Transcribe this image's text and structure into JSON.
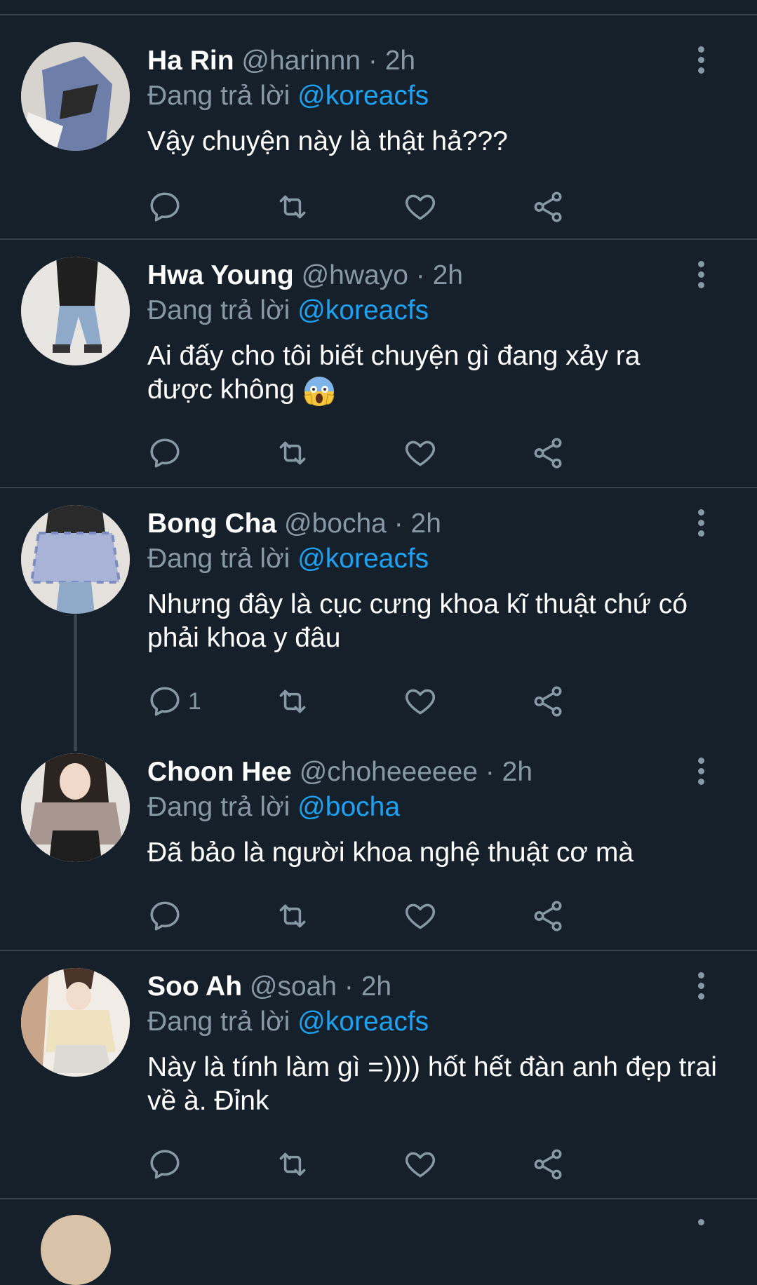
{
  "tweets": [
    {
      "name": "Ha Rin",
      "handle": "@harinnn",
      "dot": " · ",
      "time": "2h",
      "replying_prefix": "Đang trả lời ",
      "replying_to": "@koreacfs",
      "text": "Vậy chuyện này là thật hả???",
      "reply_count": ""
    },
    {
      "name": "Hwa Young",
      "handle": "@hwayo",
      "dot": " · ",
      "time": "2h",
      "replying_prefix": "Đang trả lời ",
      "replying_to": "@koreacfs",
      "text": "Ai đấy cho tôi biết chuyện gì đang xảy ra được không",
      "reply_count": ""
    },
    {
      "name": "Bong Cha",
      "handle": "@bocha",
      "dot": " · ",
      "time": "2h",
      "replying_prefix": "Đang trả lời ",
      "replying_to": "@koreacfs",
      "text": "Nhưng đây là cục cưng khoa kĩ thuật chứ có phải khoa y đâu",
      "reply_count": "1"
    },
    {
      "name": "Choon Hee",
      "handle": "@choheeeeee",
      "dot": " · ",
      "time": "2h",
      "replying_prefix": "Đang trả lời ",
      "replying_to": "@bocha",
      "text": "Đã bảo là người khoa nghệ thuật cơ mà",
      "reply_count": ""
    },
    {
      "name": "Soo Ah",
      "handle": "@soah",
      "dot": " · ",
      "time": "2h",
      "replying_prefix": "Đang trả lời ",
      "replying_to": "@koreacfs",
      "text": "Này là tính làm gì =)))) hốt hết đàn anh đẹp trai về à. Đỉnk",
      "reply_count": ""
    }
  ],
  "icons": {
    "reply": "reply-icon",
    "retweet": "retweet-icon",
    "like": "heart-icon",
    "share": "share-icon",
    "menu": "more-vertical-icon",
    "emoji": "screaming-face-emoji"
  },
  "colors": {
    "background": "#15202b",
    "secondary_text": "#8899a6",
    "mention": "#1da1f2",
    "divider": "#38444d"
  }
}
